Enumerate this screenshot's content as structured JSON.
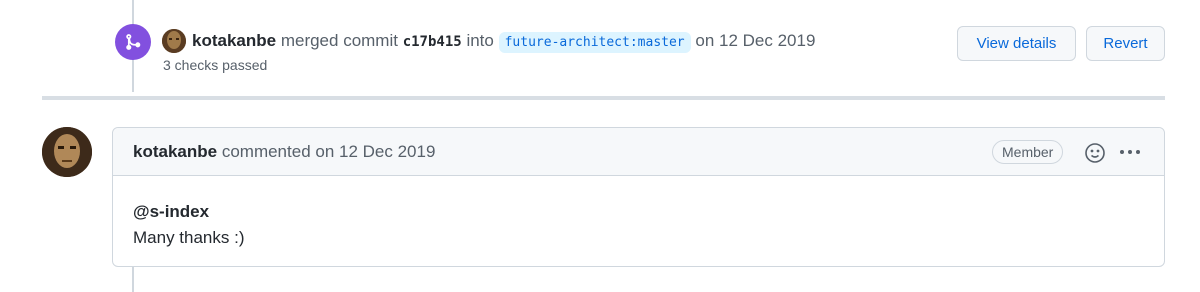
{
  "merge_event": {
    "author": "kotakanbe",
    "action": "merged commit",
    "commit_sha": "c17b415",
    "into_word": "into",
    "branch": "future-architect:master",
    "date_text": "on 12 Dec 2019",
    "checks": "3 checks passed",
    "view_details_label": "View details",
    "revert_label": "Revert",
    "badge_color": "#8250df"
  },
  "comment": {
    "author": "kotakanbe",
    "meta": "commented on 12 Dec 2019",
    "role_badge": "Member",
    "mention": "@s-index",
    "body": "Many thanks :)"
  }
}
